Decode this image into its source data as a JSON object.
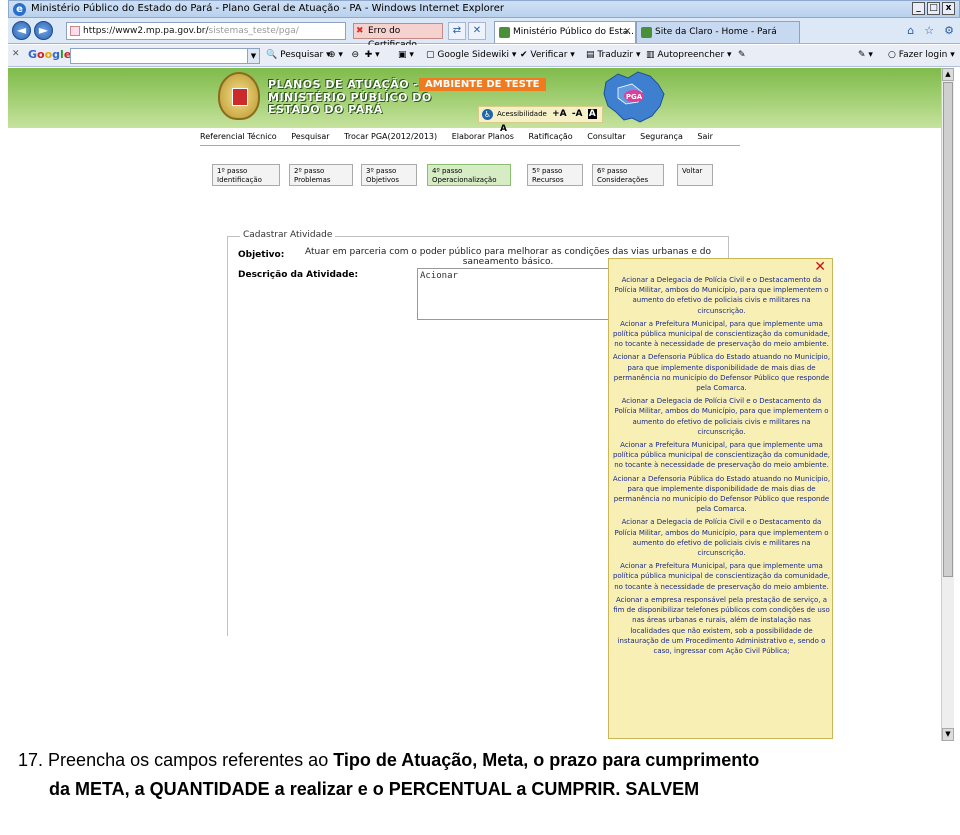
{
  "window": {
    "title": "Ministério Público do Estado do Pará - Plano Geral de Atuação - PA - Windows Internet Explorer"
  },
  "address": {
    "url_prefix": "https://www2.mp.pa.gov.br/",
    "url_rest": "sistemas_teste/pga/",
    "cert_error": "Erro do Certificado"
  },
  "tabs": [
    {
      "label": "Ministério Público do Esta..."
    },
    {
      "label": "Site da Claro - Home - Pará"
    }
  ],
  "google_toolbar": {
    "logo": "Google",
    "items": [
      "Pesquisar",
      "Google Sidewiki",
      "Verificar",
      "Traduzir",
      "Autopreencher",
      "Fazer login"
    ]
  },
  "header": {
    "line1": "PLANOS DE ATUAÇÃO - PAs",
    "line2": "MINISTÉRIO PÚBLICO DO",
    "line3": "ESTADO DO PARÁ",
    "badge": "AMBIENTE DE TESTE",
    "accessibility": "Acessibilidade",
    "font_buttons": [
      "+A",
      "-A",
      "A",
      "A"
    ],
    "map_label": "PGA"
  },
  "menu": [
    "Referencial Técnico",
    "Pesquisar",
    "Trocar PGA(2012/2013)",
    "Elaborar Planos",
    "Ratificação",
    "Consultar",
    "Segurança",
    "Sair"
  ],
  "steps": [
    {
      "n": "1º passo",
      "name": "Identificação"
    },
    {
      "n": "2º passo",
      "name": "Problemas"
    },
    {
      "n": "3º passo",
      "name": "Objetivos"
    },
    {
      "n": "4º passo",
      "name": "Operacionalização"
    },
    {
      "n": "5º passo",
      "name": "Recursos"
    },
    {
      "n": "6º passo",
      "name": "Considerações"
    },
    {
      "n": "Voltar",
      "name": ""
    }
  ],
  "form": {
    "legend": "Cadastrar Atividade",
    "objetivo_label": "Objetivo:",
    "objetivo_value": "Atuar em parceria com o poder público para melhorar as condições das vias urbanas e do saneamento básico.",
    "descricao_label": "Descrição da Atividade:",
    "descricao_value": "Acionar"
  },
  "suggestions": [
    "Acionar a Delegacia de Polícia Civil e o Destacamento da Polícia Militar, ambos do Município, para que implementem o aumento do efetivo de policiais civis e militares na circunscrição.",
    "Acionar a Prefeitura Municipal, para que implemente uma política pública municipal de conscientização da comunidade, no tocante à necessidade de preservação do meio ambiente.",
    "Acionar a Defensoria Pública do Estado atuando no Município, para que implemente disponibilidade de mais dias de permanência no município do Defensor Público que responde pela Comarca.",
    "Acionar a Delegacia de Polícia Civil e o Destacamento da Polícia Militar, ambos do Município, para que implementem o aumento do efetivo de policiais civis e militares na circunscrição.",
    "Acionar a Prefeitura Municipal, para que implemente uma política pública municipal de conscientização da comunidade, no tocante à necessidade de preservação do meio ambiente.",
    "Acionar a Defensoria Pública do Estado atuando no Município, para que implemente disponibilidade de mais dias de permanência no município do Defensor Público que responde pela Comarca.",
    "Acionar a Delegacia de Polícia Civil e o Destacamento da Polícia Militar, ambos do Município, para que implementem o aumento do efetivo de policiais civis e militares na circunscrição.",
    "Acionar a Prefeitura Municipal, para que implemente uma política pública municipal de conscientização da comunidade, no tocante à necessidade de preservação do meio ambiente.",
    "Acionar a empresa responsável pela prestação de serviço, a fim de disponibilizar telefones públicos com condições de uso nas áreas urbanas e rurais, além de instalação nas localidades que não existem, sob a possibilidade de instauração de um Procedimento Administrativo e, sendo o caso, ingressar com Ação Civil Pública;"
  ],
  "caption": {
    "number": "17.",
    "part1": "Preencha os campos referentes ao ",
    "bold1": "Tipo de Atuação, Meta, o prazo para cumprimento",
    "line2": "da META, a QUANTIDADE a realizar e o PERCENTUAL a CUMPRIR. SALVEM"
  }
}
